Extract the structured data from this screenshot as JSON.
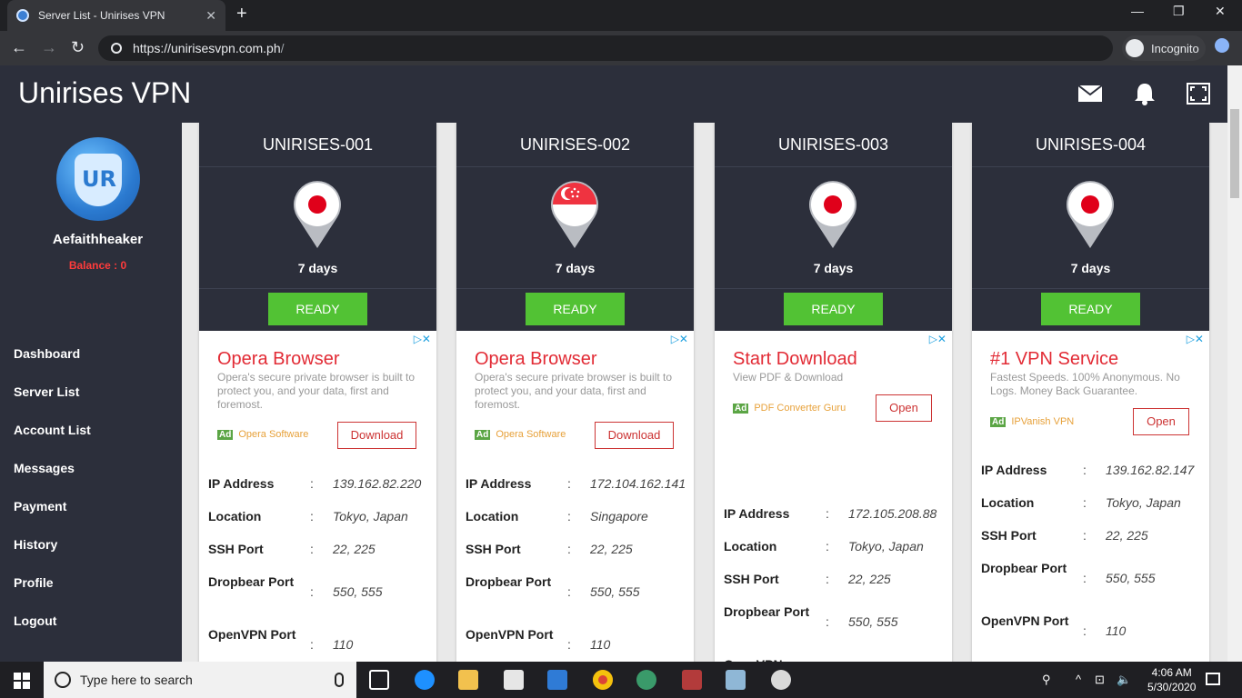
{
  "browser": {
    "tab_title": "Server List - Unirises VPN",
    "tab_close": "✕",
    "new_tab": "+",
    "url_host": "https://unirisesvpn.com.ph",
    "url_rest": "/",
    "incognito_label": "Incognito",
    "back": "←",
    "forward": "→",
    "reload": "↻",
    "minimize": "—",
    "maximize": "❐",
    "close": "✕"
  },
  "app": {
    "brand": "Unirises VPN",
    "header_icons": [
      "mail-icon",
      "bell-icon",
      "fullscreen-icon"
    ]
  },
  "sidebar": {
    "username": "Aefaithheaker",
    "balance": "Balance : 0",
    "items": [
      {
        "label": "Dashboard"
      },
      {
        "label": "Server List"
      },
      {
        "label": "Account List"
      },
      {
        "label": "Messages"
      },
      {
        "label": "Payment"
      },
      {
        "label": "History"
      },
      {
        "label": "Profile"
      },
      {
        "label": "Logout"
      }
    ]
  },
  "servers": [
    {
      "name": "UNIRISES-001",
      "flag": "japan",
      "days": "7 days",
      "status": "READY",
      "ad": {
        "title": "Opera Browser",
        "desc": "Opera's secure private browser is built to protect you, and your data, first and foremost.",
        "ad_badge": "Ad",
        "advertiser": "Opera Software",
        "button": "Download"
      },
      "ip_label": "IP Address",
      "ip": "139.162.82.220",
      "location_label": "Location",
      "location": "Tokyo, Japan",
      "ssh_label": "SSH Port",
      "ssh": "22, 225",
      "dropbear_label": "Dropbear Port",
      "dropbear": "550, 555",
      "openvpn_label": "OpenVPN Port",
      "openvpn": "110"
    },
    {
      "name": "UNIRISES-002",
      "flag": "singapore",
      "days": "7 days",
      "status": "READY",
      "ad": {
        "title": "Opera Browser",
        "desc": "Opera's secure private browser is built to protect you, and your data, first and foremost.",
        "ad_badge": "Ad",
        "advertiser": "Opera Software",
        "button": "Download"
      },
      "ip_label": "IP Address",
      "ip": "172.104.162.141",
      "location_label": "Location",
      "location": "Singapore",
      "ssh_label": "SSH Port",
      "ssh": "22, 225",
      "dropbear_label": "Dropbear Port",
      "dropbear": "550, 555",
      "openvpn_label": "OpenVPN Port",
      "openvpn": "110"
    },
    {
      "name": "UNIRISES-003",
      "flag": "japan",
      "days": "7 days",
      "status": "READY",
      "ad": {
        "title": "Start Download",
        "desc": "View PDF & Download",
        "ad_badge": "Ad",
        "advertiser": "PDF Converter Guru",
        "button": "Open"
      },
      "ip_label": "IP Address",
      "ip": "172.105.208.88",
      "location_label": "Location",
      "location": "Tokyo, Japan",
      "ssh_label": "SSH Port",
      "ssh": "22, 225",
      "dropbear_label": "Dropbear Port",
      "dropbear": "550, 555",
      "openvpn_label": "OpenVPN",
      "openvpn": ""
    },
    {
      "name": "UNIRISES-004",
      "flag": "japan",
      "days": "7 days",
      "status": "READY",
      "ad": {
        "title": "#1 VPN Service",
        "desc": "Fastest Speeds. 100% Anonymous. No Logs. Money Back Guarantee.",
        "ad_badge": "Ad",
        "advertiser": "IPVanish VPN",
        "button": "Open"
      },
      "ip_label": "IP Address",
      "ip": "139.162.82.147",
      "location_label": "Location",
      "location": "Tokyo, Japan",
      "ssh_label": "SSH Port",
      "ssh": "22, 225",
      "dropbear_label": "Dropbear Port",
      "dropbear": "550, 555",
      "openvpn_label": "OpenVPN Port",
      "openvpn": "110"
    }
  ],
  "common": {
    "colon": ":",
    "ad_choices": "▷✕"
  },
  "taskbar": {
    "search_placeholder": "Type here to search",
    "time": "4:06 AM",
    "date": "5/30/2020",
    "tray_chevron": "^",
    "tray_network": "⊡",
    "tray_volume": "🔈"
  },
  "colors": {
    "header_bg": "#2c2f3b",
    "ready_green": "#52c234",
    "ad_red": "#e22b35"
  }
}
